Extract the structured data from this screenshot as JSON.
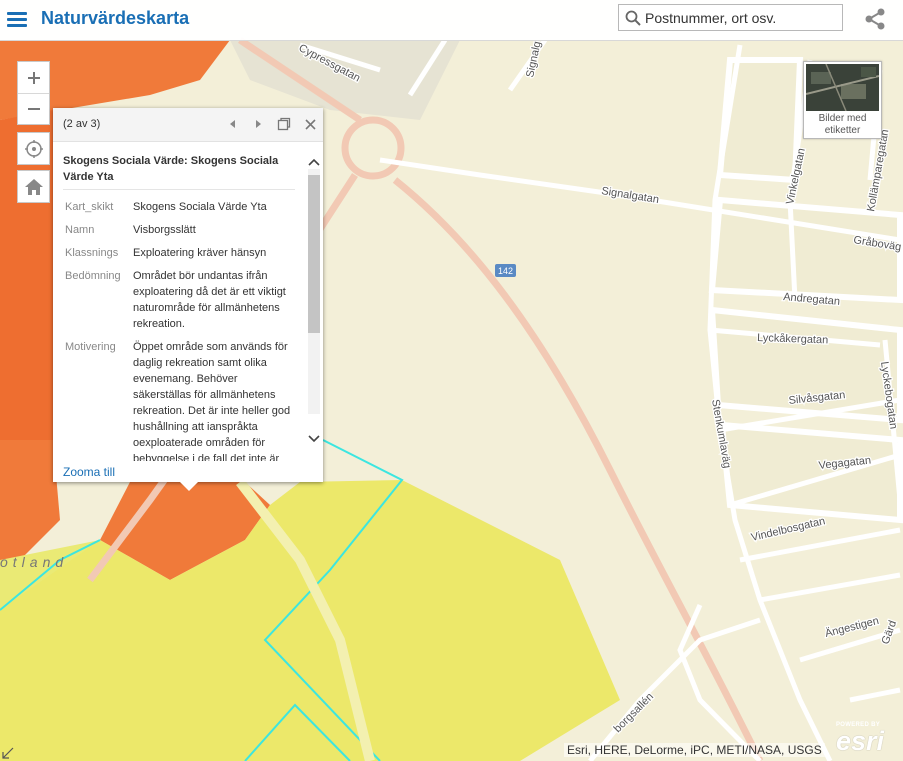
{
  "app": {
    "title": "Naturvärdeskarta"
  },
  "search": {
    "placeholder": "Postnummer, ort osv."
  },
  "basemap": {
    "label": "Bilder med etiketter"
  },
  "popup": {
    "count": "(2 av 3)",
    "title": "Skogens Sociala Värde: Skogens Sociala Värde Yta",
    "attributes": [
      {
        "key": "Kart_skikt",
        "value": "Skogens Sociala Värde Yta"
      },
      {
        "key": "Namn",
        "value": "Visborgsslätt"
      },
      {
        "key": "Klassnings",
        "value": "Exploatering kräver hänsyn"
      },
      {
        "key": "Bedömning",
        "value": "Området bör undantas ifrån exploatering då det är ett viktigt naturområde för allmänhetens rekreation."
      },
      {
        "key": "Motivering",
        "value": "Öppet område som används för daglig rekreation samt olika evenemang. Behöver säkerställas för allmänhetens rekreation. Det är inte heller god hushållning att ianspråkta oexploaterade områden för bebyggelse i de fall det inte är nödvändigt."
      }
    ],
    "zoom_link": "Zooma till"
  },
  "map_labels": {
    "cypressgatan": "Cypressgatan",
    "signalgatan_v": "Signalg",
    "signalgatan": "Signalgatan",
    "vinkelgatan": "Vinkelgatan",
    "kollamparegatan": "Kollämparegatan",
    "grabovagen": "Gråboväg",
    "andregatan": "Andregatan",
    "lyckakergatan": "Lyckåkergatan",
    "lyckebogatan": "Lyckebogatan",
    "silvasgatan": "Silvåsgatan",
    "stenkumlavag": "Stenkumlaväg",
    "vegagatan": "Vegagatan",
    "vindelbosgatan": "Vindelbosgatan",
    "angestigen": "Ängestigen",
    "garda": "Gärd",
    "borgsallen": "borgsallén",
    "route": "142",
    "region": "otland"
  },
  "attribution": "Esri, HERE, DeLorme, iPC, METI/NASA, USGS",
  "esri": {
    "powered_by": "POWERED BY",
    "logo": "esri"
  },
  "colors": {
    "brand_blue": "#1a6fb5",
    "map_bg": "#f3efd8",
    "zone_orange": "#f07a3a",
    "zone_yellow": "#ece86a",
    "zone_outline": "#3ce6e0",
    "road_major": "#f2c9b4",
    "road_minor": "#ffffff"
  },
  "icons": [
    "menu-icon",
    "search-icon",
    "share-icon",
    "zoom-in-icon",
    "zoom-out-icon",
    "locate-icon",
    "home-icon",
    "prev-icon",
    "next-icon",
    "maximize-icon",
    "close-icon",
    "chevron-up-icon",
    "chevron-down-icon"
  ]
}
